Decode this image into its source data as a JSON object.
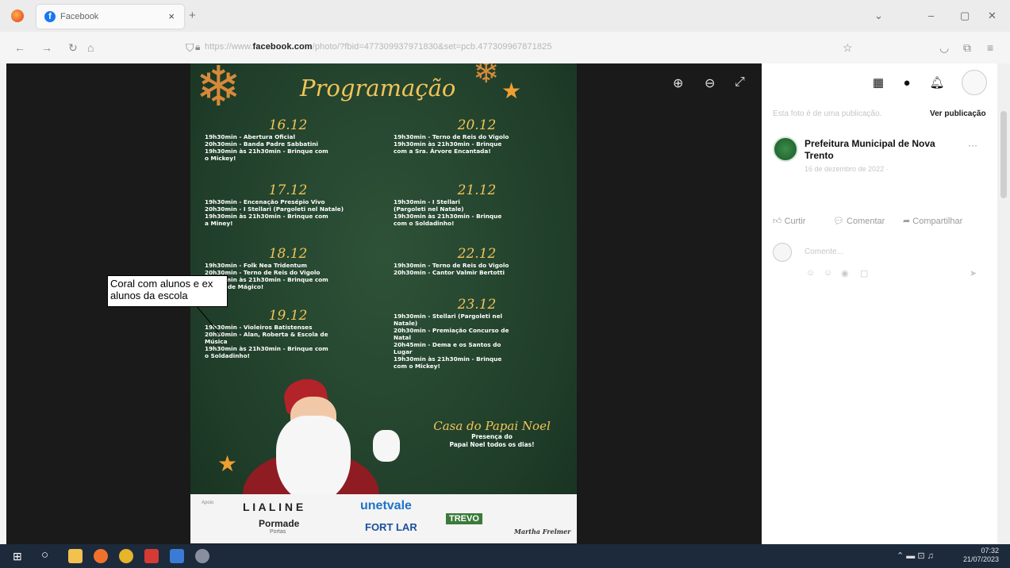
{
  "browser": {
    "tab_title": "Facebook",
    "tab_close": "×",
    "new_tab": "+",
    "url_prefix": "https://www.",
    "url_domain": "facebook.com",
    "url_rest": "/photo/?fbid=477309937971830&set=pcb.477309967871825",
    "window_controls": [
      "⌄",
      "–",
      "▢",
      "✕"
    ]
  },
  "viewer": {
    "zoom_in": "⊕",
    "zoom_out": "⊖",
    "fullscreen": "⤢"
  },
  "poster": {
    "title": "Programação",
    "days": [
      {
        "date": "16.12",
        "lines": [
          "19h30min - Abertura Oficial",
          "20h30min - Banda Padre Sabbatini",
          "19h30min às 21h30min - Brinque com",
          "o Mickey!"
        ]
      },
      {
        "date": "20.12",
        "lines": [
          "19h30min - Terno de Reis do Vigolo",
          "19h30min às 21h30min - Brinque",
          "com a Sra. Árvore Encantada!"
        ]
      },
      {
        "date": "17.12",
        "lines": [
          "19h30min - Encenação Presépio Vivo",
          "20h30min - I Stellari (Pargoleti nel Natale)",
          "19h30min às 21h30min - Brinque com",
          "a Miney!"
        ]
      },
      {
        "date": "21.12",
        "lines": [
          "19h30min - I Stellari",
          "(Pargoleti nel Natale)",
          "19h30min às 21h30min - Brinque",
          "com o Soldadinho!"
        ]
      },
      {
        "date": "18.12",
        "lines": [
          "19h30min - Folk Nea Tridentum",
          "20h30min - Terno de Reis do Vigolo",
          "19h30min às 21h30min - Brinque com",
          "o Duende Mágico!"
        ]
      },
      {
        "date": "22.12",
        "lines": [
          "19h30min - Terno de Reis do Vigolo",
          "20h30min - Cantor Valmir Bertotti"
        ]
      },
      {
        "date": "19.12",
        "lines": [
          "19h30min - Violeiros Batistenses",
          "20h30min - Alan, Roberta & Escola de",
          "Música",
          "19h30min às 21h30min - Brinque com",
          "o Soldadinho!"
        ]
      },
      {
        "date": "23.12",
        "lines": [
          "19h30min - Stellari (Pargoleti nel",
          "Natale)",
          "20h30min - Premiação Concurso de",
          "Natal",
          "20h45min - Dema e os Santos do",
          "Lugar",
          "19h30min às 21h30min - Brinque",
          "com o Mickey!"
        ]
      }
    ],
    "casa_title": "Casa do Papai Noel",
    "casa_sub_1": "Presença do",
    "casa_sub_2": "Papai Noel todos os dias!",
    "sponsors": {
      "apoio": "Apoio",
      "lialine": "L I A L I N E",
      "pormade": "Pormade",
      "pormade_sub": "Portas",
      "unetvale": "unetvale",
      "fortlar": "FORT LAR",
      "trevo": "TREVO",
      "martha": "Martha Frelmer"
    }
  },
  "callout": {
    "text": "Coral com alunos e ex alunos da escola"
  },
  "panel": {
    "info_text": "Esta foto é de uma publicação.",
    "ver_publicacao": "Ver publicação",
    "page_name": "Prefeitura Municipal de Nova Trento",
    "date": "16 de dezembro de 2022 · ",
    "more": "···",
    "curtir": "Curtir",
    "comentar": "Comentar",
    "compartilhar": "Compartilhar",
    "comment_placeholder": "Comente..."
  },
  "taskbar": {
    "time": "07:32",
    "date": "21/07/2023"
  }
}
